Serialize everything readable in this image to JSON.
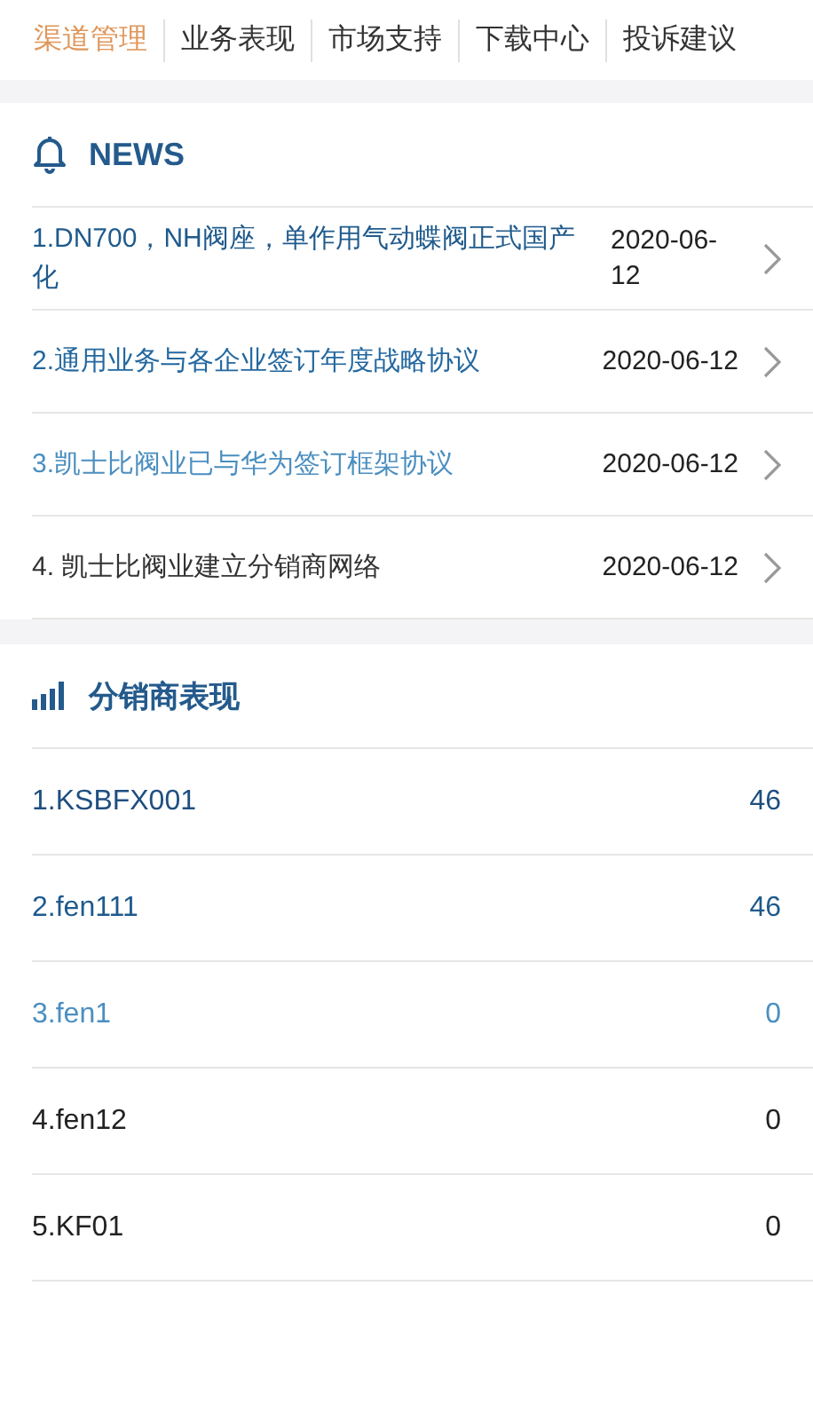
{
  "tabs": [
    {
      "label": "渠道管理",
      "selected": true
    },
    {
      "label": "业务表现",
      "selected": false
    },
    {
      "label": "市场支持",
      "selected": false
    },
    {
      "label": "下载中心",
      "selected": false
    },
    {
      "label": "投诉建议",
      "selected": false
    }
  ],
  "news": {
    "title": "NEWS",
    "items": [
      {
        "title": "1.DN700，NH阀座，单作用气动蝶阀正式国产化",
        "date": "2020-06-12",
        "color": "#1f5a8c"
      },
      {
        "title": "2.通用业务与各企业签订年度战略协议",
        "date": "2020-06-12",
        "color": "#2468a0"
      },
      {
        "title": "3.凯士比阀业已与华为签订框架协议",
        "date": "2020-06-12",
        "color": "#4b8fc0"
      },
      {
        "title": "4. 凯士比阀业建立分销商网络",
        "date": "2020-06-12",
        "color": "#333333"
      }
    ]
  },
  "distributors": {
    "title": "分销商表现",
    "rows": [
      {
        "name": "1.KSBFX001",
        "value": "46",
        "color": "#1f4f80"
      },
      {
        "name": "2.fen111",
        "value": "46",
        "color": "#1f5a8c"
      },
      {
        "name": "3.fen1",
        "value": "0",
        "color": "#4b8fc0"
      },
      {
        "name": "4.fen12",
        "value": "0",
        "color": "#222222"
      },
      {
        "name": "5.KF01",
        "value": "0",
        "color": "#222222"
      }
    ]
  }
}
